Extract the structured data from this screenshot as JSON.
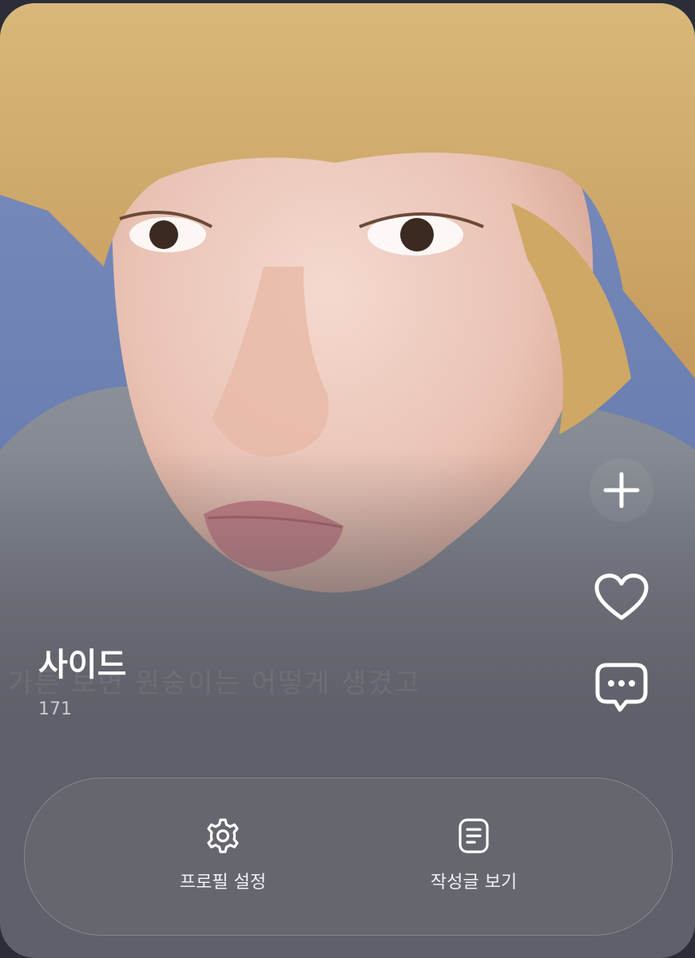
{
  "profile": {
    "name": "사이드",
    "count": "171",
    "background_caption": "가튼 보면 원숭이는 어떻게 생겼고"
  },
  "side_actions": {
    "add_icon": "plus-icon",
    "like_icon": "heart-icon",
    "comment_icon": "chat-bubble-icon"
  },
  "bottom_actions": {
    "profile_settings_label": "프로필 설정",
    "profile_settings_icon": "gear-icon",
    "view_posts_label": "작성글 보기",
    "view_posts_icon": "document-icon"
  },
  "colors": {
    "card_background": "#5f6069",
    "text_primary": "#ffffff",
    "text_secondary": "#c9cad0"
  }
}
